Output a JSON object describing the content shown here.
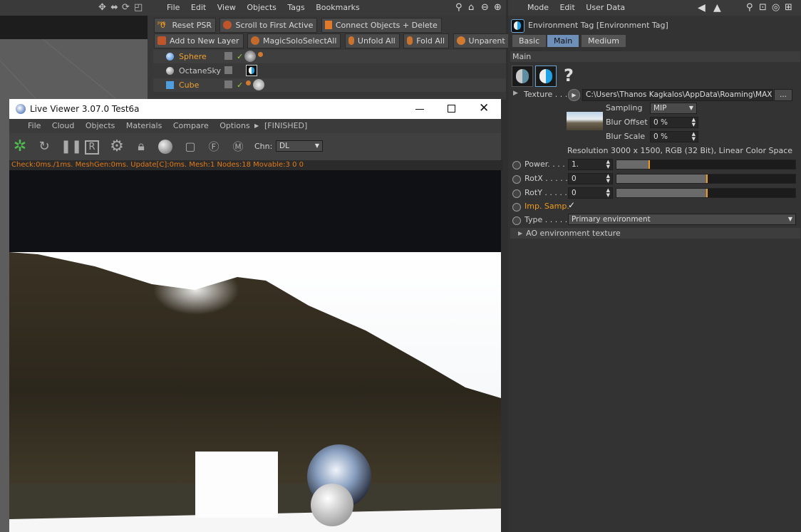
{
  "viewport": {
    "icons": [
      "move-icon",
      "rotate-icon",
      "camera-icon",
      "maximize-icon"
    ]
  },
  "object_manager": {
    "menu": [
      "File",
      "Edit",
      "View",
      "Objects",
      "Tags",
      "Bookmarks"
    ],
    "toolbar1": [
      "Reset PSR",
      "Scroll to First Active",
      "Connect Objects + Delete"
    ],
    "psr_badge": "PSR",
    "psr_zero": "0",
    "toolbar2": [
      "Add to New Layer",
      "MagicSoloSelectAll",
      "Unfold All",
      "Fold All",
      "Unparent"
    ],
    "objects": [
      {
        "name": "Sphere",
        "color": "#f0a030"
      },
      {
        "name": "OctaneSky",
        "color": "#c8c8c8"
      },
      {
        "name": "Cube",
        "color": "#f0a030"
      }
    ]
  },
  "attribute_manager": {
    "menu": [
      "Mode",
      "Edit",
      "User Data"
    ],
    "title": "Environment Tag [Environment Tag]",
    "tabs": [
      "Basic",
      "Main",
      "Medium"
    ],
    "active_tab": "Main",
    "section": "Main",
    "help_glyph": "?",
    "texture_label": "Texture . . .",
    "texture_path": "C:\\Users\\Thanos Kagkalos\\AppData\\Roaming\\MAX",
    "browse_label": "...",
    "sampling_label": "Sampling",
    "sampling_value": "MIP",
    "blur_offset_label": "Blur Offset",
    "blur_offset_value": "0 %",
    "blur_scale_label": "Blur Scale",
    "blur_scale_value": "0 %",
    "resolution": "Resolution 3000 x 1500, RGB (32 Bit), Linear Color Space",
    "power_label": "Power. . . .",
    "power_value": "1.",
    "power_level": 0.18,
    "rotx_label": "RotX . . . . .",
    "rotx_value": "0",
    "rotx_level": 0.5,
    "roty_label": "RotY . . . . .",
    "roty_value": "0",
    "roty_level": 0.5,
    "imp_samp_label": "Imp. Samp.",
    "imp_samp_check": "✓",
    "type_label": "Type . . . . .",
    "type_value": "Primary environment",
    "ao_section": "AO environment texture",
    "accent": "#ef9b1f"
  },
  "live_viewer": {
    "title": "Live Viewer 3.07.0 Test6a",
    "menu": [
      "File",
      "Cloud",
      "Objects",
      "Materials",
      "Compare",
      "Options"
    ],
    "finished": "[FINISHED]",
    "chn_label": "Chn:",
    "chn_value": "DL",
    "status": "Check:0ms./1ms. MeshGen:0ms. Update[C]:0ms. Mesh:1 Nodes:18 Movable:3  0 0",
    "window_controls": [
      "minimize-icon",
      "maximize-icon",
      "close-icon"
    ]
  }
}
